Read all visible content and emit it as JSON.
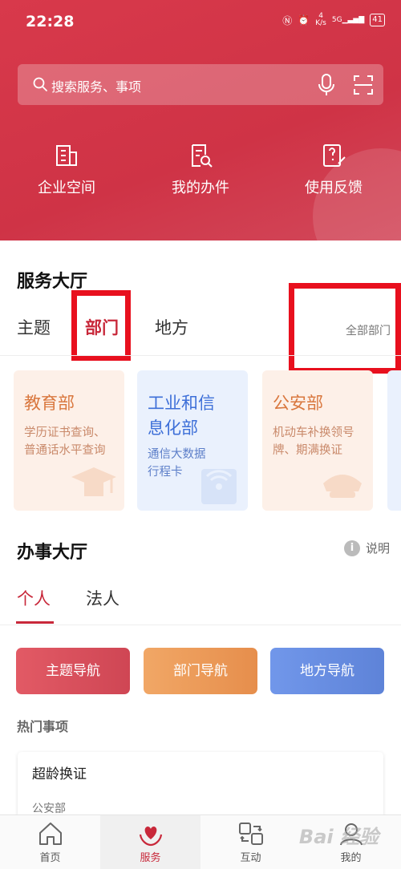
{
  "status_bar": {
    "time": "22:28",
    "net_speed_top": "4",
    "net_speed_unit": "K/s",
    "signal": "5G",
    "battery": "41"
  },
  "search": {
    "placeholder": "搜索服务、事项"
  },
  "shortcuts": [
    {
      "label": "企业空间",
      "icon": "building-icon"
    },
    {
      "label": "我的办件",
      "icon": "document-search-icon"
    },
    {
      "label": "使用反馈",
      "icon": "feedback-icon"
    }
  ],
  "service_hall": {
    "title": "服务大厅",
    "tabs": [
      "主题",
      "部门",
      "地方"
    ],
    "active_tab": "部门",
    "all_link": "全部部门",
    "departments": [
      {
        "name_line1": "教育部",
        "name_line2": "",
        "desc_line1": "学历证书查询、",
        "desc_line2": "普通话水平查询"
      },
      {
        "name_line1": "工业和信",
        "name_line2": "息化部",
        "desc_line1": "通信大数据",
        "desc_line2": "行程卡"
      },
      {
        "name_line1": "公安部",
        "name_line2": "",
        "desc_line1": "机动车补换领号",
        "desc_line2": "牌、期满换证"
      }
    ]
  },
  "office_hall": {
    "title": "办事大厅",
    "info_label": "说明",
    "tabs": [
      "个人",
      "法人"
    ],
    "active_tab": "个人",
    "nav_buttons": [
      "主题导航",
      "部门导航",
      "地方导航"
    ],
    "hot_title": "热门事项",
    "hot_items": [
      {
        "title": "超龄换证",
        "dept": "公安部"
      }
    ]
  },
  "bottom_nav": [
    "首页",
    "服务",
    "互动",
    "我的"
  ],
  "watermark": "Bai 经验",
  "colors": {
    "header_red": "#d03446",
    "accent": "#c8283a",
    "highlight_box": "#e8101e"
  }
}
